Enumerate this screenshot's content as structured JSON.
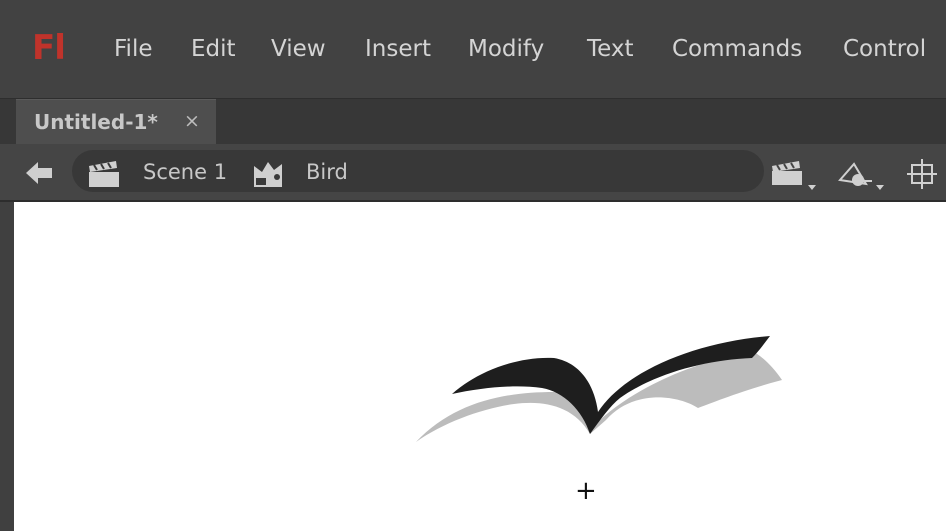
{
  "app": {
    "logo": "Fl",
    "brand_color": "#c0332b"
  },
  "menu": {
    "items": [
      "File",
      "Edit",
      "View",
      "Insert",
      "Modify",
      "Text",
      "Commands",
      "Control"
    ]
  },
  "tabs": [
    {
      "label": "Untitled-1*",
      "close": "×",
      "active": true
    }
  ],
  "editbar": {
    "back_icon": "arrow-left-icon",
    "breadcrumb": [
      {
        "label": "Scene 1",
        "icon": "clapperboard-icon"
      },
      {
        "label": "Bird",
        "icon": "graphic-symbol-icon"
      }
    ],
    "tools": [
      "edit-scene-icon",
      "edit-symbol-icon",
      "center-stage-icon"
    ]
  },
  "stage": {
    "background": "#ffffff",
    "symbol_colors": {
      "front_wing": "#1e1e1e",
      "shadow_wing": "#bcbcbc"
    },
    "registration_mark": "+"
  }
}
